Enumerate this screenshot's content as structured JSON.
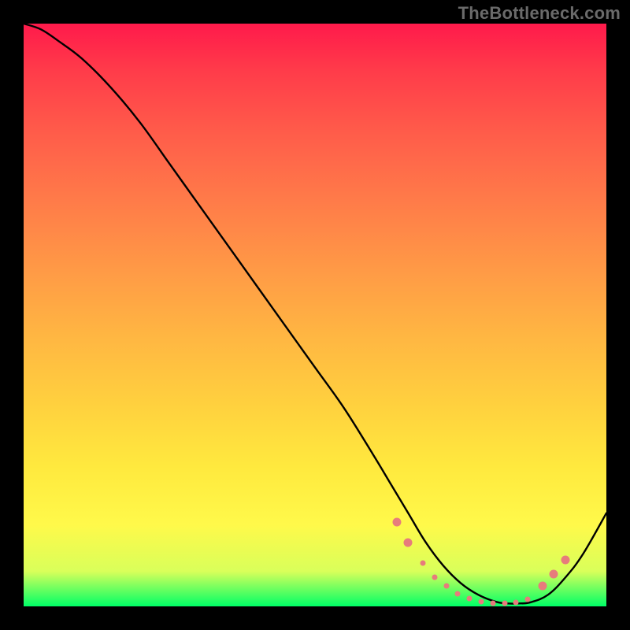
{
  "watermark": "TheBottleneck.com",
  "colors": {
    "curve": "#000000",
    "marker": "#e77c7c",
    "background_black": "#000000"
  },
  "chart_data": {
    "type": "line",
    "title": "",
    "xlabel": "",
    "ylabel": "",
    "xlim": [
      0,
      100
    ],
    "ylim": [
      0,
      100
    ],
    "grid": false,
    "series": [
      {
        "name": "bottleneck_curve",
        "x": [
          0,
          3,
          6,
          10,
          15,
          20,
          25,
          30,
          35,
          40,
          45,
          50,
          55,
          60,
          63,
          66,
          69,
          72,
          75,
          78,
          81,
          83,
          85,
          87,
          90,
          93,
          96,
          100
        ],
        "y": [
          100,
          99,
          97,
          94,
          89,
          83,
          76,
          69,
          62,
          55,
          48,
          41,
          34,
          26,
          21,
          16,
          11,
          7,
          4,
          2,
          0.8,
          0.5,
          0.5,
          0.7,
          2,
          5,
          9,
          16
        ]
      }
    ],
    "markers": [
      {
        "x": 64.0,
        "y": 14.5,
        "size": "big"
      },
      {
        "x": 66.0,
        "y": 11.0,
        "size": "big"
      },
      {
        "x": 68.5,
        "y": 7.5,
        "size": "small"
      },
      {
        "x": 70.5,
        "y": 5.0,
        "size": "small"
      },
      {
        "x": 72.5,
        "y": 3.5,
        "size": "small"
      },
      {
        "x": 74.5,
        "y": 2.2,
        "size": "small"
      },
      {
        "x": 76.5,
        "y": 1.3,
        "size": "small"
      },
      {
        "x": 78.5,
        "y": 0.8,
        "size": "small"
      },
      {
        "x": 80.5,
        "y": 0.5,
        "size": "small"
      },
      {
        "x": 82.5,
        "y": 0.5,
        "size": "small"
      },
      {
        "x": 84.5,
        "y": 0.7,
        "size": "small"
      },
      {
        "x": 86.5,
        "y": 1.2,
        "size": "small"
      },
      {
        "x": 89.0,
        "y": 3.5,
        "size": "big"
      },
      {
        "x": 91.0,
        "y": 5.5,
        "size": "big"
      },
      {
        "x": 93.0,
        "y": 8.0,
        "size": "big"
      }
    ],
    "legend": null
  }
}
